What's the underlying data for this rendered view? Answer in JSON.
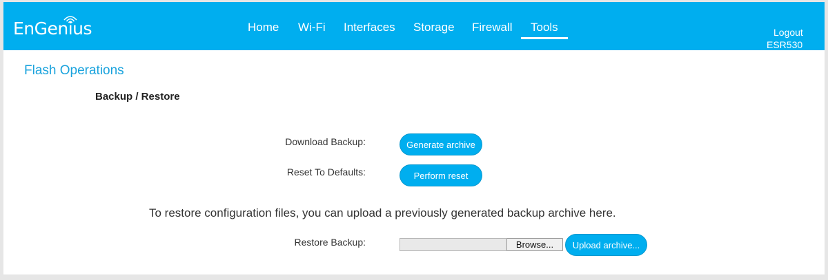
{
  "brand": {
    "name": "EnGenius",
    "color": "#00aeef",
    "icon": "wifi-waves-icon"
  },
  "nav": {
    "items": [
      {
        "label": "Home"
      },
      {
        "label": "Wi-Fi"
      },
      {
        "label": "Interfaces"
      },
      {
        "label": "Storage"
      },
      {
        "label": "Firewall"
      },
      {
        "label": "Tools",
        "active": true
      }
    ]
  },
  "header": {
    "logout": "Logout",
    "model": "ESR530"
  },
  "page": {
    "title": "Flash Operations",
    "subheading": "Backup / Restore"
  },
  "rows": {
    "download": {
      "label": "Download Backup:",
      "button": "Generate archive"
    },
    "reset": {
      "label": "Reset To Defaults:",
      "button": "Perform reset"
    },
    "restore_help": "To restore configuration files, you can upload a previously generated backup archive here.",
    "restore": {
      "label": "Restore Backup:",
      "browse": "Browse...",
      "upload": "Upload archive..."
    }
  }
}
